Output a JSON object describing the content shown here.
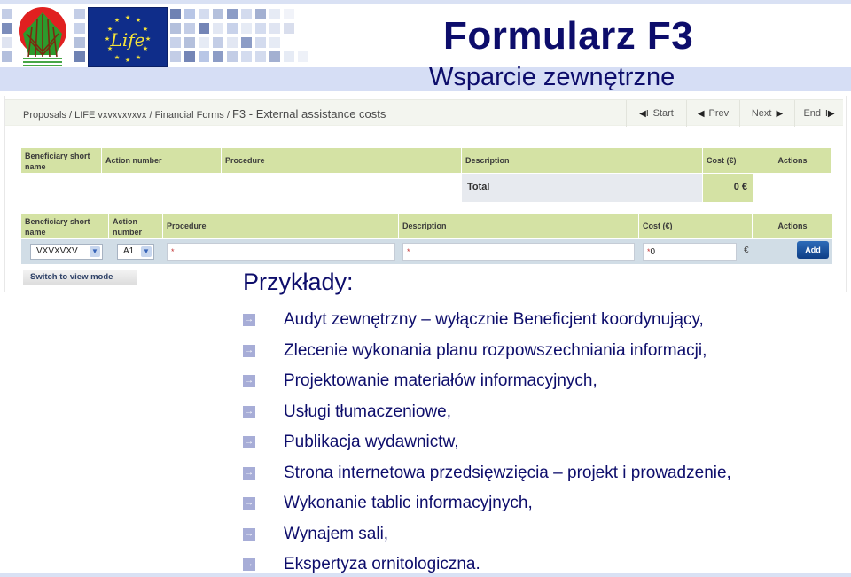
{
  "slide": {
    "title": "Formularz F3",
    "subtitle": "Wsparcie zewnętrzne",
    "logos": [
      "poland-nfosigw-logo",
      "eu-life-logo"
    ],
    "life_logo_text": "Life",
    "colors": {
      "title": "#0d0d6b",
      "band": "#d6def5",
      "bullet": "#a7add7",
      "header_green": "#d4e2a4",
      "add_button": "#1a4f9c"
    }
  },
  "app": {
    "breadcrumb": {
      "items": [
        "Proposals",
        "LIFE vxvxvxvxvx",
        "Financial Forms"
      ],
      "separator": " / ",
      "current": "F3 - External assistance costs"
    },
    "nav": {
      "start": "Start",
      "prev": "Prev",
      "next": "Next",
      "end": "End",
      "start_glyph": "◀I",
      "prev_glyph": "◀",
      "next_glyph": "▶",
      "end_glyph": "I▶"
    },
    "summary_table": {
      "headers": {
        "beneficiary": "Beneficiary short name",
        "action": "Action number",
        "procedure": "Procedure",
        "description": "Description",
        "cost": "Cost (€)",
        "actions": "Actions"
      },
      "total_label": "Total",
      "total_value": "0 €"
    },
    "entry_table": {
      "headers": {
        "beneficiary": "Beneficiary short name",
        "action": "Action number",
        "procedure": "Procedure",
        "description": "Description",
        "cost": "Cost (€)",
        "actions": "Actions"
      },
      "beneficiary_value": "VXVXVXV",
      "action_value": "A1",
      "procedure_value": "",
      "description_value": "",
      "required_marker": "*",
      "cost_value": "0",
      "currency": "€",
      "add_label": "Add"
    },
    "switch_mode_label": "Switch to view mode"
  },
  "examples": {
    "title": "Przykłady:",
    "items": [
      "Audyt zewnętrzny – wyłącznie Beneficjent koordynujący,",
      "Zlecenie wykonania planu rozpowszechniania informacji,",
      "Projektowanie materiałów informacyjnych,",
      "Usługi tłumaczeniowe,",
      "Publikacja wydawnictw,",
      "Strona internetowa przedsięwzięcia – projekt i prowadzenie,",
      "Wykonanie tablic informacyjnych,",
      "Wynajem sali,",
      "Ekspertyza ornitologiczna."
    ]
  }
}
